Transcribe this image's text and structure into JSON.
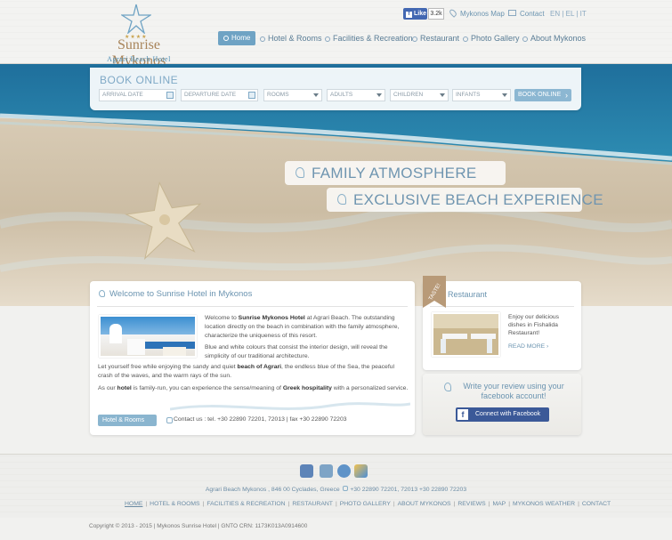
{
  "brand": {
    "name": "Sunrise Mykonos",
    "subtitle": "Agrari Beach Hotel",
    "stars": "★★★★"
  },
  "topbar": {
    "fb_like": "Like",
    "fb_count": "3.2k",
    "map_link": "Mykonos Map",
    "contact_link": "Contact",
    "languages": "EN | EL | IT"
  },
  "nav": [
    {
      "label": "Home",
      "active": true
    },
    {
      "label": "Hotel & Rooms"
    },
    {
      "label": "Facilities & Recreation"
    },
    {
      "label": "Restaurant"
    },
    {
      "label": "Photo Gallery"
    },
    {
      "label": "About Mykonos"
    }
  ],
  "booking": {
    "title": "BOOK ONLINE",
    "fields": [
      "ARRIVAL DATE",
      "DEPARTURE DATE",
      "ROOMS",
      "ADULTS",
      "CHILDREN",
      "INFANTS"
    ],
    "button": "BOOK ONLINE"
  },
  "slogans": [
    "FAMILY ATMOSPHERE",
    "EXCLUSIVE BEACH EXPERIENCE"
  ],
  "welcome": {
    "title": "Welcome to Sunrise Hotel in Mykonos",
    "p1a": "Welcome to ",
    "p1b": "Sunrise Mykonos Hotel",
    "p1c": " at Agrari Beach. The outstanding location directly on the beach in combination with the family atmosphere, characterize the uniqueness of this resort.",
    "p2": "Blue and white colours that consist the interior design, will reveal the simplicity of our traditional architecture.",
    "p3a": "Let yourself free while enjoying the sandy and quiet ",
    "p3b": "beach of Agrari",
    "p3c": ", the endless blue of the Sea, the peaceful crash of the waves, and the warm rays of the sun.",
    "p4a": "As our ",
    "p4b": "hotel",
    "p4c": " is family-run, you can experience the sense/meaning of ",
    "p4d": "Greek hospitality",
    "p4e": " with a personalized service.",
    "button": "Hotel & Rooms",
    "contact": "Contact us : tel. +30 22890 72201, 72013 | fax +30 22890 72203"
  },
  "restaurant": {
    "badge": "TASTE!",
    "title": "Restaurant",
    "text": "Enjoy our delicious dishes in Fishalida Restaurant!",
    "more": "READ MORE"
  },
  "review": {
    "text": "Write your review using your facebook account!",
    "button": "Connect with Facebook"
  },
  "footer": {
    "address": "Agrari Beach Mykonos , 846 00 Cyclades, Greece",
    "phone": "+30 22890 72201, 72013 +30 22890 72203",
    "links": [
      "HOME",
      "HOTEL & ROOMS",
      "FACILITIES & RECREATION",
      "RESTAURANT",
      "PHOTO GALLERY",
      "ABOUT MYKONOS",
      "REVIEWS",
      "MAP",
      "MYKONOS WEATHER",
      "CONTACT"
    ],
    "copyright": "Copyright © 2013 - 2015 | Mykonos Sunrise Hotel | GNTO CRN: 1173K013A0914600"
  },
  "colors": {
    "accent": "#6fa3c4",
    "brand_gold": "#a8845a",
    "facebook": "#3b5998"
  }
}
